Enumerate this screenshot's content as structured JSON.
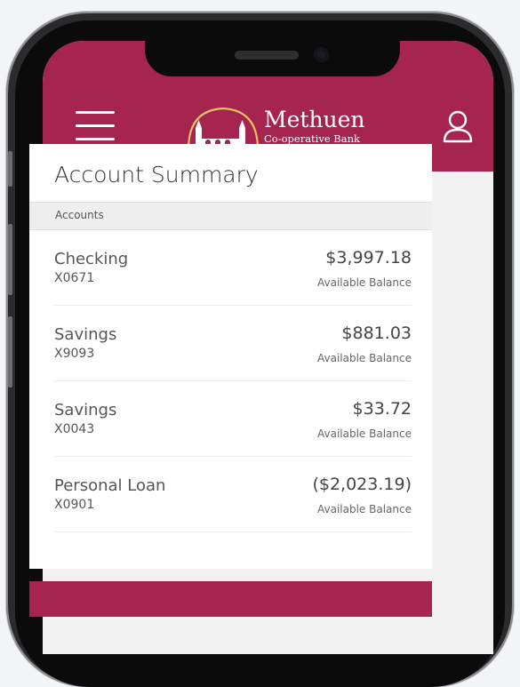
{
  "header": {
    "brand_name": "Methuen",
    "brand_sub": "Co-operative Bank",
    "brand_color": "#a52450",
    "menu_icon": "hamburger-menu-icon",
    "user_icon": "user-profile-icon"
  },
  "summary": {
    "title": "Account Summary",
    "section_label": "Accounts"
  },
  "accounts": [
    {
      "name": "Checking",
      "number": "X0671",
      "balance": "$3,997.18",
      "balance_label": "Available Balance"
    },
    {
      "name": "Savings",
      "number": "X9093",
      "balance": "$881.03",
      "balance_label": "Available Balance"
    },
    {
      "name": "Savings",
      "number": "X0043",
      "balance": "$33.72",
      "balance_label": "Available Balance"
    },
    {
      "name": "Personal Loan",
      "number": "X0901",
      "balance": "($2,023.19)",
      "balance_label": "Available Balance"
    }
  ]
}
